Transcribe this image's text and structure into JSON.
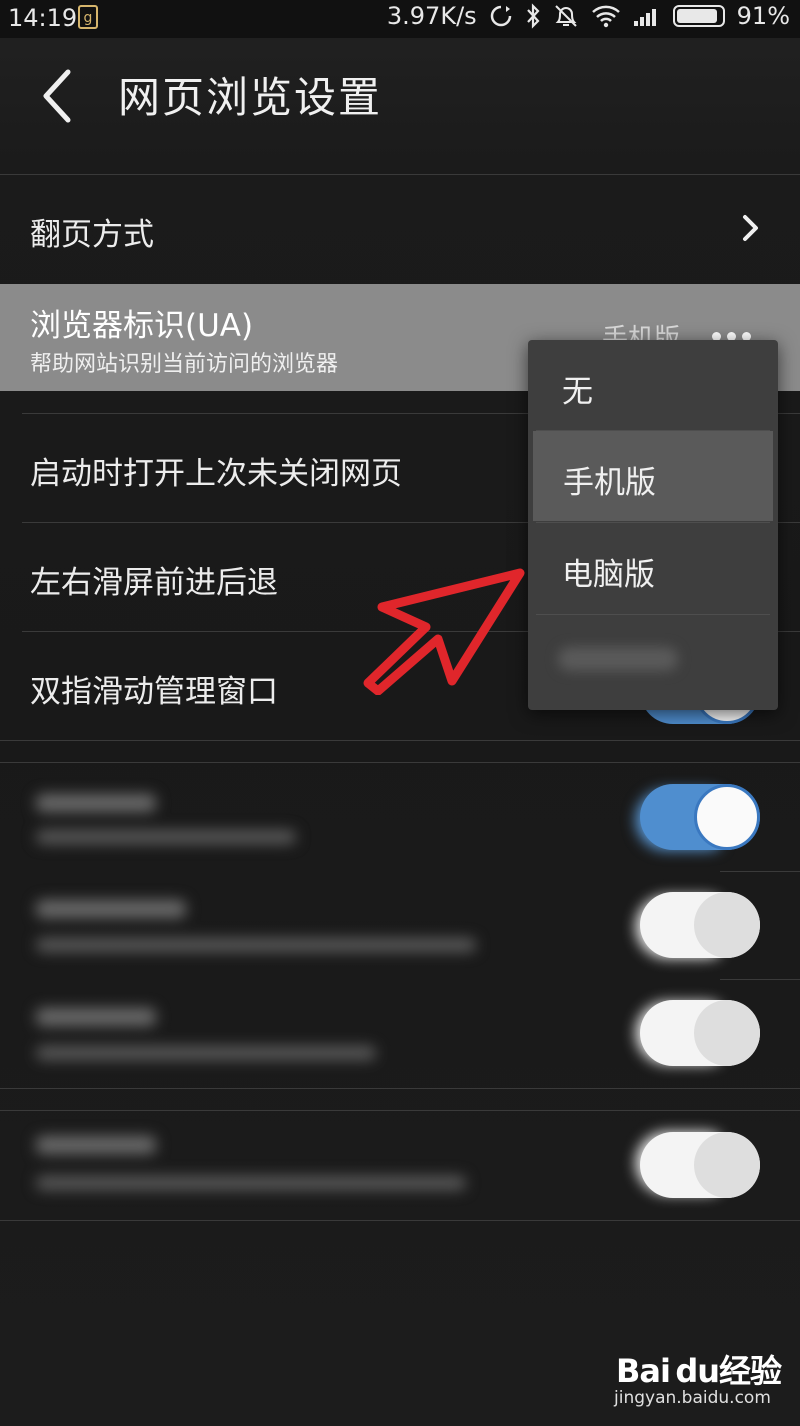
{
  "status_bar": {
    "time": "14:19",
    "app_icon_glyph": "g",
    "net_speed": "3.97K/s",
    "battery": "91%",
    "battery_level": 0.91,
    "icons": [
      "sync-icon",
      "bluetooth-icon",
      "alarm-off-icon",
      "wifi-icon",
      "signal-icon",
      "battery-icon"
    ]
  },
  "header": {
    "title": "网页浏览设置",
    "back_icon": "back-arrow-icon"
  },
  "rows": {
    "page_turn": {
      "title": "翻页方式"
    },
    "ua": {
      "title": "浏览器标识(UA)",
      "subtitle": "帮助网站识别当前访问的浏览器",
      "value": "手机版"
    },
    "restore_pages": {
      "title": "启动时打开上次未关闭网页"
    },
    "swipe_nav": {
      "title": "左右滑屏前进后退"
    },
    "two_finger": {
      "title": "双指滑动管理窗口"
    }
  },
  "dropdown": {
    "options": [
      "无",
      "手机版",
      "电脑版"
    ],
    "selected": "手机版"
  },
  "colors": {
    "background": "#181818",
    "ua_row_highlight": "#8b8b8b",
    "dropdown_bg": "#3e3e3e",
    "toggle_on": "#4f8ecf",
    "annotation_arrow": "#e0262b"
  },
  "watermark": {
    "logo": "Bai du经验",
    "url": "jingyan.baidu.com"
  }
}
